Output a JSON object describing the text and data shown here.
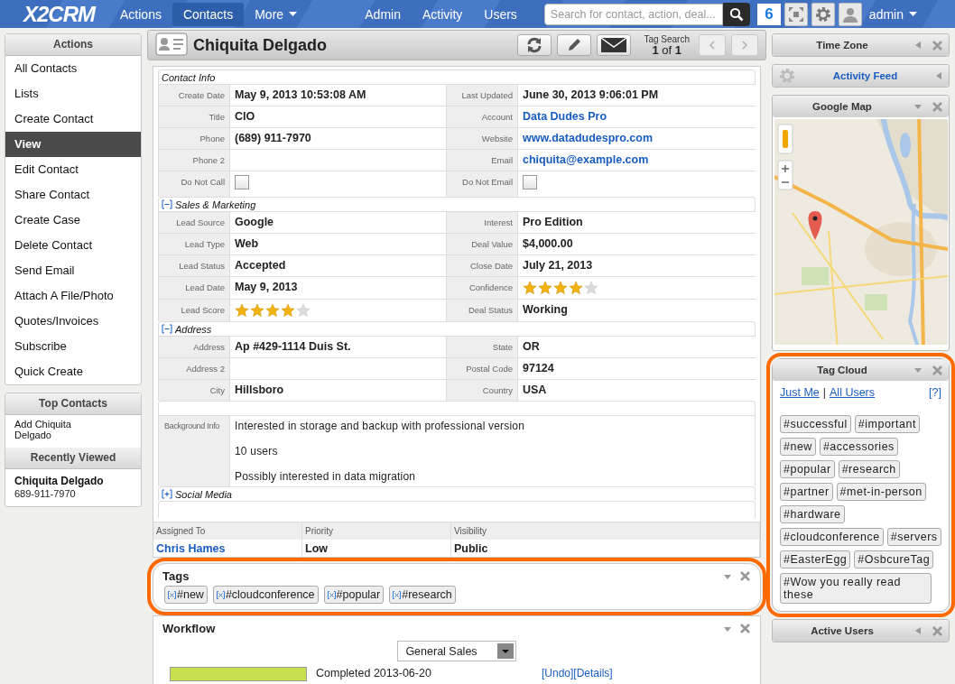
{
  "nav": {
    "logo": "X2CRM",
    "left_items": [
      {
        "label": "Actions",
        "selected": false,
        "dropdown": false
      },
      {
        "label": "Contacts",
        "selected": true,
        "dropdown": false
      },
      {
        "label": "More",
        "selected": false,
        "dropdown": true
      }
    ],
    "right_items": [
      {
        "label": "Admin"
      },
      {
        "label": "Activity"
      },
      {
        "label": "Users"
      }
    ],
    "search": {
      "placeholder": "Search for contact, action, deal..."
    },
    "notifications": "6",
    "user": "admin"
  },
  "actions_panel": {
    "title": "Actions",
    "items": [
      {
        "label": "All Contacts",
        "selected": false
      },
      {
        "label": "Lists",
        "selected": false
      },
      {
        "label": "Create Contact",
        "selected": false
      },
      {
        "label": "View",
        "selected": true
      },
      {
        "label": "Edit Contact",
        "selected": false
      },
      {
        "label": "Share Contact",
        "selected": false
      },
      {
        "label": "Create Case",
        "selected": false
      },
      {
        "label": "Delete Contact",
        "selected": false
      },
      {
        "label": "Send Email",
        "selected": false
      },
      {
        "label": "Attach A File/Photo",
        "selected": false
      },
      {
        "label": "Quotes/Invoices",
        "selected": false
      },
      {
        "label": "Subscribe",
        "selected": false
      },
      {
        "label": "Quick Create",
        "selected": false
      }
    ]
  },
  "top_contacts": {
    "title": "Top Contacts",
    "items": [
      "Add Chiquita Delgado"
    ]
  },
  "recently_viewed": {
    "title": "Recently Viewed",
    "items": [
      {
        "name": "Chiquita Delgado",
        "phone": "689-911-7970"
      }
    ]
  },
  "contact": {
    "name": "Chiquita Delgado",
    "tag_search": {
      "label": "Tag Search",
      "position": "**1** of **1**"
    },
    "sections": [
      {
        "title": "Contact Info",
        "rows": [
          [
            {
              "label": "Create Date",
              "value": "May 9, 2013 10:53:08 AM",
              "kind": "text"
            },
            {
              "label": "Last Updated",
              "value": "June 30, 2013 9:06:01 PM",
              "kind": "text"
            }
          ],
          [
            {
              "label": "Title",
              "value": "CIO",
              "kind": "text"
            },
            {
              "label": "Account",
              "value": "Data Dudes Pro",
              "kind": "link"
            }
          ],
          [
            {
              "label": "Phone",
              "value": "(689) 911-7970",
              "kind": "text"
            },
            {
              "label": "Website",
              "value": "www.datadudespro.com",
              "kind": "link"
            }
          ],
          [
            {
              "label": "Phone 2",
              "kind": "text"
            },
            {
              "label": "Email",
              "value": "chiquita@example.com",
              "kind": "link"
            }
          ],
          [
            {
              "label": "Do Not Call",
              "kind": "checkbox",
              "checked": false
            },
            {
              "label": "Do Not Email",
              "kind": "checkbox",
              "checked": false
            }
          ]
        ]
      },
      {
        "title": "Sales & Marketing",
        "expanded": true,
        "rows": [
          [
            {
              "label": "Lead Source",
              "value": "Google",
              "kind": "text"
            },
            {
              "label": "Interest",
              "value": "Pro Edition",
              "kind": "text"
            }
          ],
          [
            {
              "label": "Lead Type",
              "value": "Web",
              "kind": "text"
            },
            {
              "label": "Deal Value",
              "value": "$4,000.00",
              "kind": "text"
            }
          ],
          [
            {
              "label": "Lead Status",
              "value": "Accepted",
              "kind": "text"
            },
            {
              "label": "Close Date",
              "value": "July 21, 2013",
              "kind": "text"
            }
          ],
          [
            {
              "label": "Lead Date",
              "value": "May 9, 2013",
              "kind": "text"
            },
            {
              "label": "Confidence",
              "kind": "stars",
              "stars": 4
            }
          ],
          [
            {
              "label": "Lead Score",
              "kind": "stars",
              "stars": 4
            },
            {
              "label": "Deal Status",
              "value": "Working",
              "kind": "text"
            }
          ]
        ]
      },
      {
        "title": "Address",
        "expanded": true,
        "rows": [
          [
            {
              "label": "Address",
              "value": "Ap #429-1114 Duis St.",
              "kind": "text"
            },
            {
              "label": "State",
              "value": "OR",
              "kind": "text"
            }
          ],
          [
            {
              "label": "Address 2",
              "kind": "text"
            },
            {
              "label": "Postal Code",
              "value": "97124",
              "kind": "text"
            }
          ],
          [
            {
              "label": "City",
              "value": "Hillsboro",
              "kind": "text"
            },
            {
              "label": "Country",
              "value": "USA",
              "kind": "text"
            }
          ]
        ]
      },
      {
        "rows": [
          [
            {
              "label": "Background Info",
              "kind": "paragraphs",
              "paragraphs": [
                "Interested in storage and backup with professional version",
                "10 users",
                "Possibly interested in data migration"
              ]
            }
          ]
        ]
      },
      {
        "title": "Social Media",
        "expanded": false
      }
    ],
    "assignment": [
      {
        "label": "Assigned To",
        "value": "Chris Hames",
        "kind": "link"
      },
      {
        "label": "Priority",
        "value": "Low",
        "kind": "text"
      },
      {
        "label": "Visibility",
        "value": "Public",
        "kind": "text"
      }
    ]
  },
  "tags_widget": {
    "title": "Tags",
    "highlighted": true,
    "tags": [
      "#new",
      "#cloudconference",
      "#popular",
      "#research"
    ]
  },
  "workflow": {
    "title": "Workflow",
    "selected": "General Sales",
    "stage_done": "Completed 2013-06-20",
    "links": [
      "[Undo]",
      "[Details]"
    ]
  },
  "right_widgets": [
    {
      "kind": "plain",
      "title": "Time Zone",
      "collapsed": true
    },
    {
      "kind": "feed",
      "title": "Activity Feed",
      "collapsed": true
    },
    {
      "kind": "map",
      "title": "Google Map",
      "collapsed": false
    },
    {
      "kind": "tagcloud",
      "title": "Tag Cloud",
      "collapsed": false,
      "highlighted": true,
      "filters": [
        "Just Me",
        "All Users"
      ],
      "separator": "|",
      "help": "[?]",
      "tags": [
        "#successful",
        "#important",
        "#new",
        "#accessories",
        "#popular",
        "#research",
        "#partner",
        "#met-in-person",
        "#hardware",
        "#cloudconference",
        "#servers",
        "#EasterEgg",
        "#OsbcureTag",
        "#Wow you really read these"
      ]
    },
    {
      "kind": "plain",
      "title": "Active Users",
      "collapsed": true
    }
  ]
}
